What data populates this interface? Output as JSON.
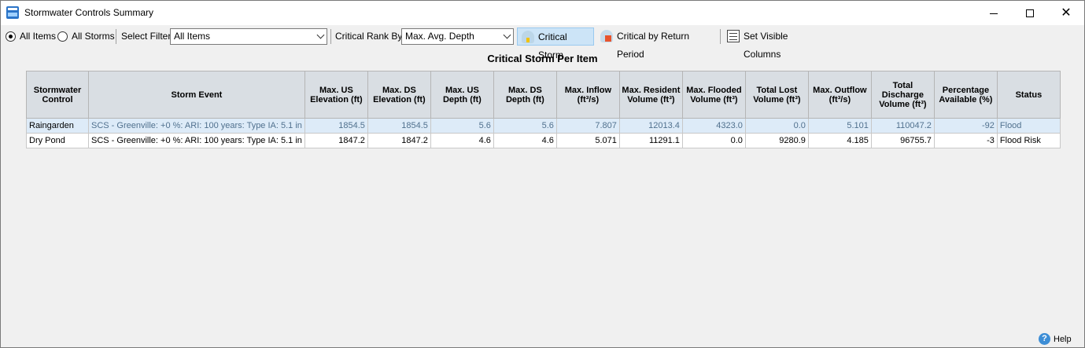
{
  "window": {
    "title": "Stormwater Controls Summary",
    "app_icon": "sum-app-icon"
  },
  "toolbar": {
    "all_items_label": "All Items",
    "all_storms_label": "All Storms",
    "selected_scope": "All Items",
    "select_filter_label": "Select Filter",
    "filter_value": "All Items",
    "critical_rank_label": "Critical Rank By:",
    "critical_rank_value": "Max. Avg. Depth",
    "critical_storm_label": "Critical Storm",
    "critical_by_return_label": "Critical by Return Period",
    "set_visible_columns_label": "Set Visible Columns"
  },
  "heading": "Critical Storm Per Item",
  "table": {
    "columns": [
      "Stormwater Control",
      "Storm Event",
      "Max. US Elevation (ft)",
      "Max. DS Elevation (ft)",
      "Max. US Depth (ft)",
      "Max. DS Depth (ft)",
      "Max. Inflow (ft³/s)",
      "Max. Resident Volume (ft³)",
      "Max. Flooded Volume (ft³)",
      "Total Lost Volume (ft³)",
      "Max. Outflow (ft³/s)",
      "Total Discharge Volume (ft³)",
      "Percentage Available (%)",
      "Status"
    ],
    "rows": [
      [
        "Raingarden",
        "SCS - Greenville: +0 %: ARI: 100 years: Type IA: 5.1 in",
        "1854.5",
        "1854.5",
        "5.6",
        "5.6",
        "7.807",
        "12013.4",
        "4323.0",
        "0.0",
        "5.101",
        "110047.2",
        "-92",
        "Flood"
      ],
      [
        "Dry Pond",
        "SCS - Greenville: +0 %: ARI: 100 years: Type IA: 5.1 in",
        "1847.2",
        "1847.2",
        "4.6",
        "4.6",
        "5.071",
        "11291.1",
        "0.0",
        "9280.9",
        "4.185",
        "96755.7",
        "-3",
        "Flood Risk"
      ]
    ],
    "selected_row": 0
  },
  "help_label": "Help",
  "colors": {
    "header_bg": "#d9dee3",
    "selected_row_bg": "#ddebf8",
    "active_button_bg": "#cce4f7"
  }
}
